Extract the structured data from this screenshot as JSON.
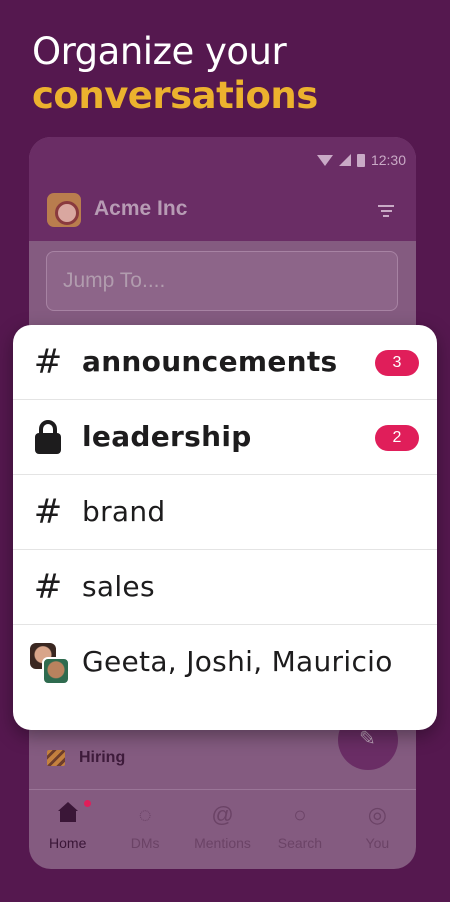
{
  "headline": {
    "line1": "Organize your",
    "line2": "conversations"
  },
  "colors": {
    "background": "#55184f",
    "accent_yellow": "#ecb22e",
    "badge_red": "#e01e5a"
  },
  "status_bar": {
    "time": "12:30",
    "icons": [
      "wifi-icon",
      "cell-signal-icon",
      "battery-icon"
    ]
  },
  "workspace": {
    "name": "Acme Inc",
    "filter_icon": "filter-icon"
  },
  "search": {
    "placeholder": "Jump To...."
  },
  "channels": [
    {
      "icon": "#",
      "name": "announcements",
      "bold": true,
      "badge": "3"
    },
    {
      "icon": "lock-icon",
      "name": "leadership",
      "bold": true,
      "badge": "2"
    },
    {
      "icon": "#",
      "name": "brand",
      "bold": false
    },
    {
      "icon": "#",
      "name": "sales",
      "bold": false
    },
    {
      "icon": "group-avatar-icon",
      "name": "Geeta, Joshi, Mauricio",
      "bold": false
    }
  ],
  "hiring": {
    "label": "Hiring"
  },
  "tabs": [
    {
      "label": "Home",
      "icon": "home-icon",
      "active": true
    },
    {
      "label": "DMs",
      "icon": "dms-icon",
      "active": false
    },
    {
      "label": "Mentions",
      "icon": "mentions-icon",
      "active": false
    },
    {
      "label": "Search",
      "icon": "search-icon",
      "active": false
    },
    {
      "label": "You",
      "icon": "you-icon",
      "active": false
    }
  ]
}
